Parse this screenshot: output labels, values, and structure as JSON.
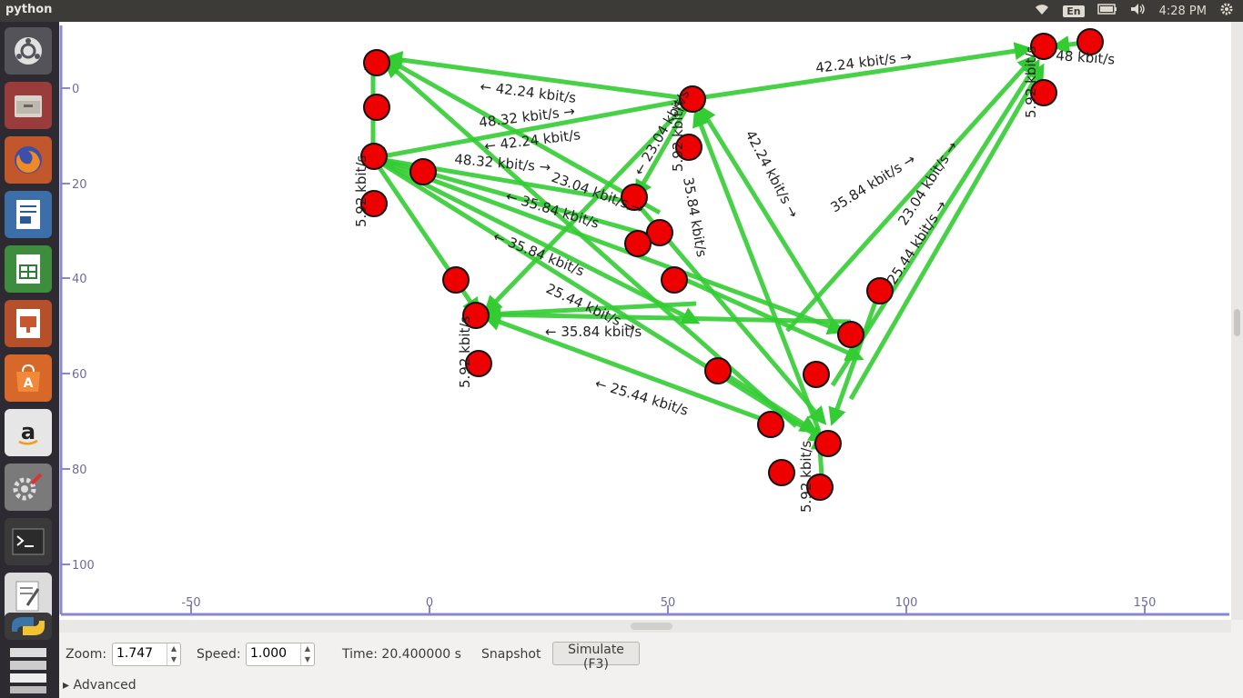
{
  "top_bar": {
    "app_title": "python",
    "language": "En",
    "clock": "4:28 PM",
    "indicators": [
      "wifi-icon",
      "keyboard-language-icon",
      "battery-icon",
      "volume-icon",
      "gear-icon"
    ]
  },
  "launcher": {
    "items": [
      "ubuntu-dash-icon",
      "files-icon",
      "firefox-icon",
      "libreoffice-writer-icon",
      "libreoffice-calc-icon",
      "libreoffice-impress-icon",
      "software-center-icon",
      "amazon-icon",
      "system-settings-icon",
      "terminal-icon",
      "text-editor-icon",
      "python-icon",
      "workspaces-icon"
    ]
  },
  "plot": {
    "x_ticks": [
      "-50",
      "0",
      "50",
      "100",
      "150"
    ],
    "y_ticks": [
      "0",
      "20",
      "40",
      "60",
      "80",
      "100"
    ],
    "link_labels": [
      "← 42.24 kbit/s",
      "48.32 kbit/s →",
      "← 42.24 kbit/s",
      "48.32 kbit/s →",
      "42.24 kbit/s →",
      "35.84 kbit/s →",
      "23.04 kbit/s →",
      "25.44 kbit/s →",
      "← 35.84 kbit/s",
      "← 35.84 kbit/s",
      "← 25.44 kbit/s",
      "25.44 kbit/s →",
      "42.24 kbit/s →",
      "35.84 kbit/s",
      "← 35.84 kbit/s",
      "23.04 kbit/s →",
      "← 23.04 kbit/s",
      "5.92 kbit/s",
      "5.92 kbit/s",
      "5.92 kbit/s",
      "5.92 kbit/s",
      "5.92 kbit/s",
      "48 kbit/s"
    ]
  },
  "controls": {
    "zoom_label": "Zoom:",
    "zoom_value": "1.747",
    "speed_label": "Speed:",
    "speed_value": "1.000",
    "time_text": "Time: 20.400000 s",
    "snapshot_label": "Snapshot",
    "simulate_label": "Simulate (F3)",
    "advanced_label": "Advanced"
  },
  "colors": {
    "link": "#33cc33",
    "node": "#ee0000",
    "axis": "#8888cc",
    "topbar": "#3c3b37",
    "launcher": "#2d2a31"
  }
}
